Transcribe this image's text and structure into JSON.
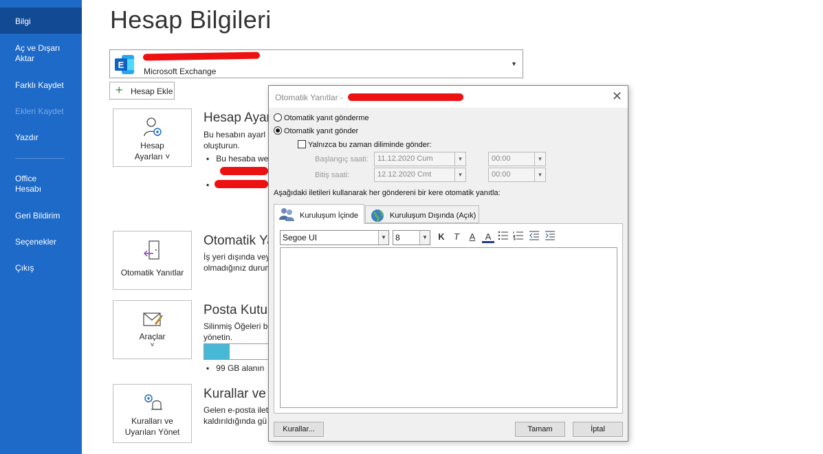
{
  "sidebar": {
    "items": [
      {
        "label": "Bilgi",
        "state": "active"
      },
      {
        "label": "Aç ve Dışarı Aktar"
      },
      {
        "label": "Farklı Kaydet"
      },
      {
        "label": "Ekleri Kaydet",
        "state": "disabled"
      },
      {
        "label": "Yazdır"
      },
      {
        "label": "Office Hesabı"
      },
      {
        "label": "Geri Bildirim"
      },
      {
        "label": "Seçenekler"
      },
      {
        "label": "Çıkış"
      }
    ]
  },
  "main": {
    "title": "Hesap Bilgileri",
    "account": {
      "type": "Microsoft Exchange",
      "icon": "exchange-icon",
      "brand_color": "#0f63c3"
    },
    "add_account_label": "Hesap Ekle",
    "sections": [
      {
        "tile_label_line1": "Hesap",
        "tile_label_line2": "Ayarları ˅",
        "title": "Hesap Ayar",
        "text_line1": "Bu hesabın ayarl",
        "text_line2": "oluşturun.",
        "bullet1": "Bu hesaba we",
        "icon": "account-settings-icon"
      },
      {
        "tile_label_line1": "Otomatik Yanıtlar",
        "title": "Otomatik Ya",
        "text_line1": "İş yeri dışında veya",
        "text_line2": "olmadığınız durum",
        "icon": "auto-replies-icon"
      },
      {
        "tile_label_line1": "Araçlar",
        "tile_label_line2": "˅",
        "title": "Posta Kutus",
        "text_line1": "Silinmiş Öğeleri bo",
        "text_line2": "yönetin.",
        "bullet1": "99 GB alanın",
        "mailbox_fill_fraction": 0.38,
        "icon": "tools-icon"
      },
      {
        "tile_label_line1": "Kuralları ve",
        "tile_label_line2": "Uyarıları Yönet",
        "title": "Kurallar ve U",
        "text_line1": "Gelen e-posta ileti",
        "text_line2": "kaldırıldığında gü",
        "icon": "rules-alerts-icon"
      }
    ]
  },
  "dialog": {
    "title": "Otomatik Yanıtlar - ",
    "close_glyph": "✕",
    "radio_off": "Otomatik yanıt gönderme",
    "radio_on": "Otomatik yanıt gönder",
    "time_range_check": "Yalnızca bu zaman diliminde gönder:",
    "start_label": "Başlangıç saati:",
    "start_date": "11.12.2020 Cum",
    "start_time": "00:00",
    "end_label": "Bitiş saati:",
    "end_date": "12.12.2020 Cmt",
    "end_time": "00:00",
    "instructions": "Aşağıdaki iletileri kullanarak her göndereni bir kere otomatik yanıtla:",
    "tabs": [
      {
        "label": "Kuruluşum İçinde",
        "active": true,
        "icon": "people-icon"
      },
      {
        "label": "Kuruluşum Dışında (Açık)",
        "active": false,
        "icon": "globe-icon"
      }
    ],
    "font_name": "Segoe UI",
    "font_size": "8",
    "format_buttons": {
      "bold": "K",
      "italic": "T",
      "underline": "A",
      "font_color": "A"
    },
    "rules_button": "Kurallar...",
    "ok_button": "Tamam",
    "cancel_button": "İptal"
  }
}
